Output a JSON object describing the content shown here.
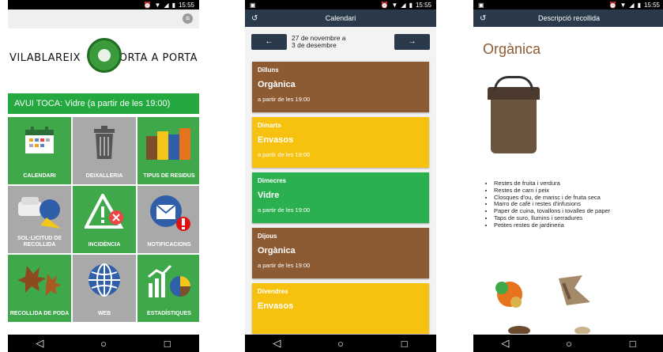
{
  "status": {
    "time": "15:55"
  },
  "phone1": {
    "brand_left": "VILABLAREIX",
    "brand_right": "PORTA A PORTA",
    "today": "AVUI TOCA: Vidre (a partir de les 19:00)",
    "tiles": [
      {
        "label": "CALENDARI",
        "color": "green",
        "icon": "calendar-icon"
      },
      {
        "label": "DEIXALLERIA",
        "color": "grey",
        "icon": "trash-can-icon"
      },
      {
        "label": "TIPUS DE RESIDUS",
        "color": "green",
        "icon": "bins-icon"
      },
      {
        "label": "SOL·LICITUD DE RECOLLIDA",
        "color": "grey",
        "icon": "sofa-truck-icon"
      },
      {
        "label": "INCIDÈNCIA",
        "color": "green",
        "icon": "warning-icon"
      },
      {
        "label": "NOTIFICACIONS",
        "color": "grey",
        "icon": "envelope-icon"
      },
      {
        "label": "RECOLLIDA DE PODA",
        "color": "green",
        "icon": "leaf-icon"
      },
      {
        "label": "WEB",
        "color": "grey",
        "icon": "globe-icon"
      },
      {
        "label": "ESTADÍSTIQUES",
        "color": "green",
        "icon": "stats-icon"
      }
    ]
  },
  "phone2": {
    "title": "Calendari",
    "week_line1": "27 de novembre a",
    "week_line2": "3 de desembre",
    "days": [
      {
        "day": "Dilluns",
        "type": "Orgànica",
        "hour": "a partir de les 19:00",
        "color": "brown"
      },
      {
        "day": "Dimarts",
        "type": "Envasos",
        "hour": "a partir de les 19:00",
        "color": "yellow"
      },
      {
        "day": "Dimecres",
        "type": "Vidre",
        "hour": "a partir de les 19:00",
        "color": "green"
      },
      {
        "day": "Dijous",
        "type": "Orgànica",
        "hour": "a partir de les 19:00",
        "color": "brown"
      },
      {
        "day": "Divendres",
        "type": "Envasos",
        "hour": "",
        "color": "yellow"
      }
    ]
  },
  "phone3": {
    "title": "Descripció recollida",
    "heading": "Orgànica",
    "items": [
      "Restes de fruita i verdura",
      "Restes de carn i peix",
      "Closques d'ou, de marisc i de fruita seca",
      "Marro de cafè i restes d'infusions",
      "Paper de cuina, tovallons i tovalles de paper",
      "Taps de suro, llumins i serradures",
      "Petites restes de jardineria"
    ]
  }
}
